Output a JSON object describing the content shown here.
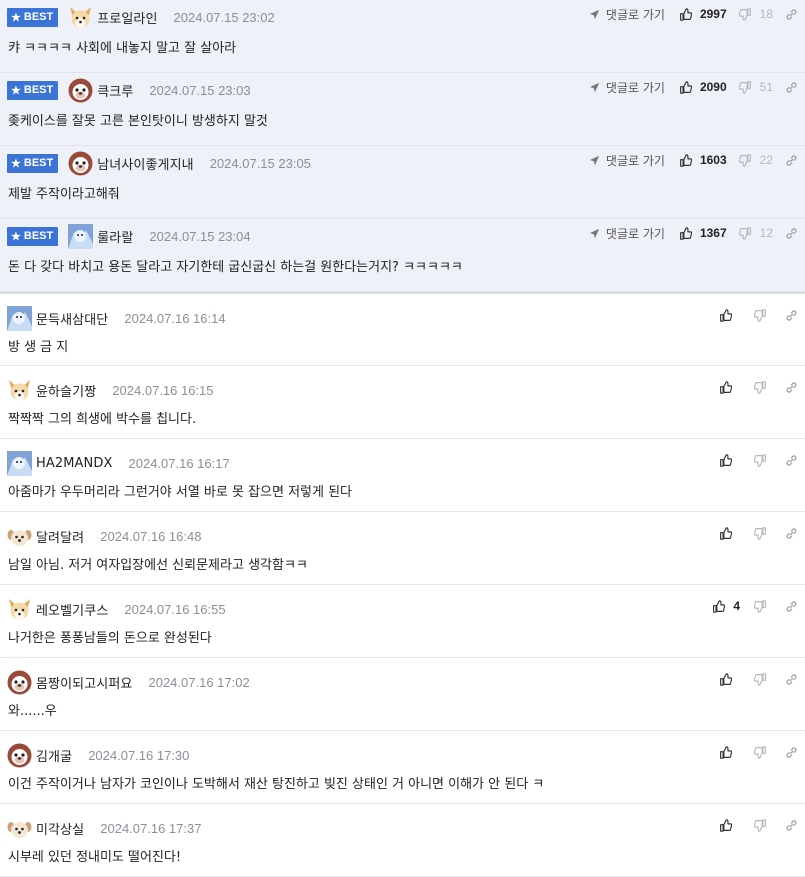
{
  "labels": {
    "best": "BEST",
    "reply": "댓글로 가기"
  },
  "colors": {
    "best_badge": "#3b73d6",
    "best_bg": "#eef1f8",
    "date": "#8a8f99"
  },
  "best_comments": [
    {
      "nick": "프로일라인",
      "date": "2024.07.15 23:02",
      "text": "캬 ㅋㅋㅋㅋ 사회에 내놓지 말고 잘 살아라",
      "up": "2997",
      "down": "18",
      "avatar": "fox-avatar"
    },
    {
      "nick": "큭크루",
      "date": "2024.07.15 23:03",
      "text": "좆케이스를 잘못 고른 본인탓이니 방생하지 말것",
      "up": "2090",
      "down": "51",
      "avatar": "pug-avatar"
    },
    {
      "nick": "남녀사이좋게지내",
      "date": "2024.07.15 23:05",
      "text": "제발 주작이라고해줘",
      "up": "1603",
      "down": "22",
      "avatar": "pug-avatar"
    },
    {
      "nick": "룰라랄",
      "date": "2024.07.15 23:04",
      "text": "돈 다 갖다 바치고 용돈 달라고 자기한테 굽신굽신 하는걸 원한다는거지? ㅋㅋㅋㅋㅋ",
      "up": "1367",
      "down": "12",
      "avatar": "frost-avatar"
    }
  ],
  "comments": [
    {
      "nick": "문득새삼대단",
      "date": "2024.07.16 16:14",
      "text": "방 생 금 지",
      "up": "",
      "avatar": "frost-avatar"
    },
    {
      "nick": "윤하슬기짱",
      "date": "2024.07.16 16:15",
      "text": "짝짝짝 그의 희생에 박수를 칩니다.",
      "up": "",
      "avatar": "fox-avatar"
    },
    {
      "nick": "HA2MANDX",
      "date": "2024.07.16 16:17",
      "text": "아줌마가 우두머리라 그런거야 서열 바로 못 잡으면 저렇게 된다",
      "up": "",
      "avatar": "frost-avatar"
    },
    {
      "nick": "달려달려",
      "date": "2024.07.16 16:48",
      "text": "남일 아님. 저거 여자입장에선 신뢰문제라고 생각함ㅋㅋ",
      "up": "",
      "avatar": "puppy-avatar"
    },
    {
      "nick": "레오벨기쿠스",
      "date": "2024.07.16 16:55",
      "text": "나거한은 퐁퐁남들의 돈으로 완성된다",
      "up": "4",
      "avatar": "fox-avatar"
    },
    {
      "nick": "몸짱이되고시퍼요",
      "date": "2024.07.16 17:02",
      "text": "와......우",
      "up": "",
      "avatar": "pug-avatar"
    },
    {
      "nick": "김개굴",
      "date": "2024.07.16 17:30",
      "text": "이건 주작이거나 남자가 코인이나 도박해서 재산 탕진하고 빚진 상태인 거 아니면 이해가 안 된다 ㅋ",
      "up": "",
      "avatar": "pug-avatar"
    },
    {
      "nick": "미각상실",
      "date": "2024.07.16 17:37",
      "text": "시부레 있던 정내미도 떨어진다!",
      "up": "",
      "avatar": "puppy-avatar"
    }
  ]
}
